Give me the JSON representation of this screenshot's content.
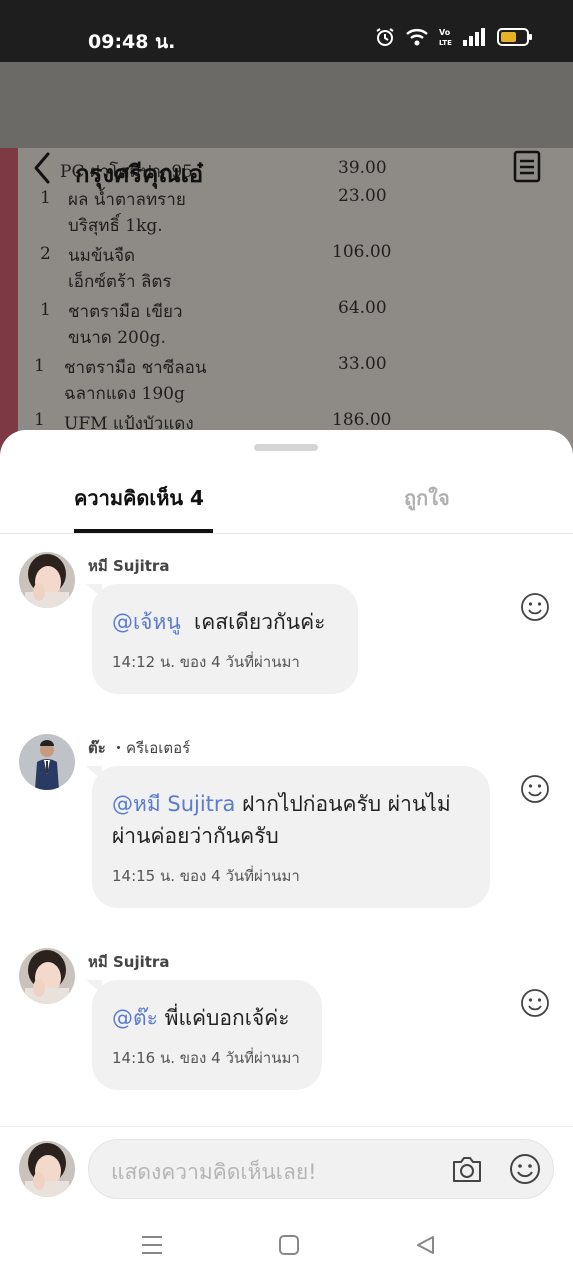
{
  "status_bar": {
    "time": "09:48 น.",
    "icons": [
      "alarm-icon",
      "wifi-icon",
      "volte-icon",
      "signal-icon",
      "battery-icon"
    ]
  },
  "header": {
    "title": "กรุงศรีคุณเอ๋",
    "back_icon": "back-arrow-icon",
    "menu_icon": "document-icon"
  },
  "background_receipt": {
    "lines": [
      {
        "text": "PC ฝาโดมปาก95",
        "price": "39.00"
      },
      {
        "text": "ผล น้ำตาลทราย",
        "price": "23.00"
      },
      {
        "text": "บริสุทธิ์ 1kg.",
        "price": ""
      },
      {
        "text": "นมข้นจืด",
        "price": "106.00"
      },
      {
        "text": "เอ็กซ์ตร้า ลิตร",
        "price": ""
      },
      {
        "text": "ชาตรามือ เขียว",
        "price": "64.00"
      },
      {
        "text": "ขนาด 200g.",
        "price": ""
      },
      {
        "text": "ชาตรามือ ชาซีลอน",
        "price": "33.00"
      },
      {
        "text": "ฉลากแดง 190g",
        "price": ""
      },
      {
        "text": "UFM แป้งบัวแดง",
        "price": "186.00"
      }
    ],
    "qty": [
      "1",
      "2",
      "1",
      "1",
      "1"
    ]
  },
  "tabs": {
    "comments": "ความคิดเห็น 4",
    "likes": "ถูกใจ"
  },
  "comments": [
    {
      "author": "หมี Sujitra",
      "role": "",
      "mention": "@เจ้หนู",
      "text": "เคสเดียวกันค่ะ",
      "meta": "14:12 น. ของ 4 วันที่ผ่านมา"
    },
    {
      "author": "ต๊ะ",
      "role": "・ครีเอเตอร์",
      "mention": "@หมี Sujitra",
      "text": "ฝากไปก่อนครับ ผ่านไม่ผ่านค่อยว่ากันครับ",
      "meta": "14:15 น. ของ 4 วันที่ผ่านมา"
    },
    {
      "author": "หมี Sujitra",
      "role": "",
      "mention": "@ต๊ะ",
      "text": "พี่แค่บอกเจ้ค่ะ",
      "meta": "14:16 น. ของ 4 วันที่ผ่านมา"
    }
  ],
  "input": {
    "placeholder": "แสดงความคิดเห็นเลย!",
    "camera_icon": "camera-icon",
    "emoji_icon": "emoji-icon"
  },
  "nav": {
    "icons": [
      "menu-icon",
      "home-square-icon",
      "back-triangle-icon"
    ]
  },
  "colors": {
    "mention": "#5a7bd0",
    "bubble": "#f1f1f1",
    "tab_active": "#111111",
    "tab_inactive": "#b0b0b0"
  }
}
